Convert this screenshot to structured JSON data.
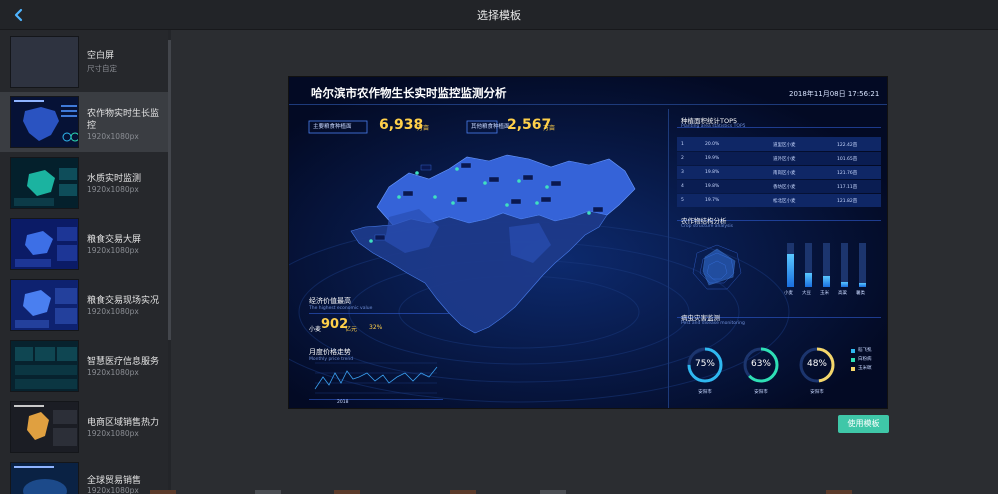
{
  "header": {
    "title": "选择模板"
  },
  "sidebar": {
    "items": [
      {
        "name": "空白屏",
        "sub": "尺寸自定"
      },
      {
        "name": "农作物实时生长监控",
        "sub": "1920x1080px"
      },
      {
        "name": "水质实时监测",
        "sub": "1920x1080px"
      },
      {
        "name": "粮食交易大屏",
        "sub": "1920x1080px"
      },
      {
        "name": "粮食交易现场实况",
        "sub": "1920x1080px"
      },
      {
        "name": "智慧医疗信息服务",
        "sub": "1920x1080px"
      },
      {
        "name": "电商区域销售热力",
        "sub": "1920x1080px"
      },
      {
        "name": "全球贸易销售",
        "sub": "1920x1080px"
      }
    ]
  },
  "preview": {
    "title": "哈尔滨市农作物生长实时监控监测分析",
    "datetime": "2018年11月08日  17:56:21",
    "stat1": {
      "label": "主要粮食种植面",
      "value": "6,938",
      "unit": "万亩"
    },
    "stat2": {
      "label": "其他粮食种植面",
      "value": "2,567",
      "unit": "万亩"
    },
    "econ": {
      "title": "经济价值最高",
      "sub": "The highest economic value",
      "crop": "小麦",
      "value": "902",
      "unit": "亿元",
      "change": "32%"
    },
    "price": {
      "title": "月度价格走势",
      "sub": "Monthly price trend",
      "year": "2018"
    },
    "top5": {
      "title": "种植面积统计TOP5",
      "sub": "Planting area statistics TOP5",
      "rows": [
        {
          "rank": "1",
          "pct": "20.0%",
          "name": "道里区小麦",
          "area": "122.42亩"
        },
        {
          "rank": "2",
          "pct": "19.9%",
          "name": "道外区小麦",
          "area": "101.65亩"
        },
        {
          "rank": "3",
          "pct": "19.8%",
          "name": "南岗区小麦",
          "area": "121.76亩"
        },
        {
          "rank": "4",
          "pct": "19.8%",
          "name": "香坊区小麦",
          "area": "117.11亩"
        },
        {
          "rank": "5",
          "pct": "19.7%",
          "name": "松北区小麦",
          "area": "121.82亩"
        }
      ]
    },
    "structure": {
      "title": "农作物结构分析",
      "sub": "Crop structure analysis"
    },
    "pest": {
      "title": "病虫灾害监测",
      "sub": "Pest and disease monitoring",
      "rings": [
        {
          "pct": "75%",
          "label": "安阳市",
          "value": 0.75,
          "color": "#2fb8f0"
        },
        {
          "pct": "63%",
          "label": "安阳市",
          "value": 0.63,
          "color": "#2ee0b5"
        },
        {
          "pct": "48%",
          "label": "安阳市",
          "value": 0.48,
          "color": "#f4d66a"
        }
      ],
      "legend": [
        {
          "label": "稻飞虱",
          "color": "#2fb8f0"
        },
        {
          "label": "白粉病",
          "color": "#2ee0b5"
        },
        {
          "label": "玉米螟",
          "color": "#f4d66a"
        }
      ]
    },
    "bars": [
      {
        "cat": "小麦",
        "value": 0.75
      },
      {
        "cat": "大豆",
        "value": 0.32
      },
      {
        "cat": "玉米",
        "value": 0.25
      },
      {
        "cat": "高粱",
        "value": 0.12
      },
      {
        "cat": "薯类",
        "value": 0.1
      }
    ]
  },
  "actions": {
    "use_template": "使用模板"
  }
}
